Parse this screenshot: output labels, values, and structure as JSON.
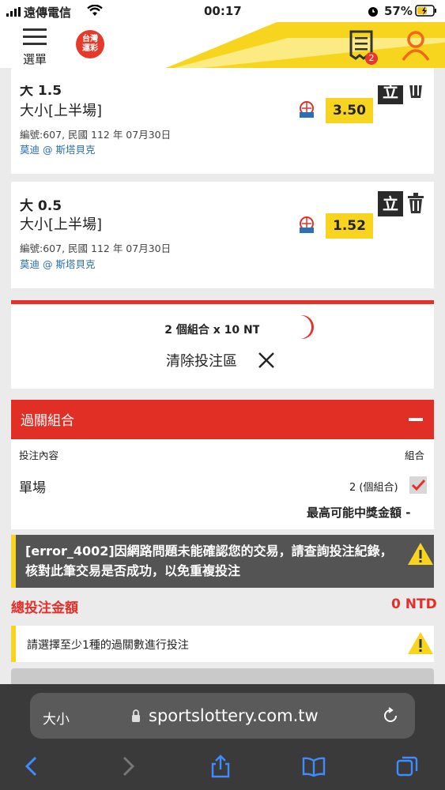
{
  "status_bar": {
    "carrier": "遠傳電信",
    "time": "00:17",
    "battery": "57%"
  },
  "header": {
    "menu_label": "選單",
    "logo_text": "台灣\n運彩",
    "bet_slip_count": "2"
  },
  "bets": [
    {
      "odds_title": "大 1.5",
      "market": "大小[上半場]",
      "meta": "編號:607, 民國 112 年 07月30日",
      "match": "莫迪 @ 斯塔貝克",
      "odds": "3.50",
      "action": "立"
    },
    {
      "odds_title": "大 0.5",
      "market": "大小[上半場]",
      "meta": "編號:607, 民國 112 年 07月30日",
      "match": "莫迪 @ 斯塔貝克",
      "odds": "1.52",
      "action": "立"
    }
  ],
  "stake": {
    "summary": "2 個組合 x 10 NTD x",
    "clear_label": "清除投注區"
  },
  "parlay": {
    "title": "過關組合",
    "header_content": "投注內容",
    "header_combo": "組合",
    "type_label": "單場",
    "combo_count": "2 (個組合)",
    "max_payout_label": "最高可能中獎金額 -"
  },
  "error_message": "[error_4002]因網路問題未能確認您的交易，請查詢投注紀錄，核對此筆交易是否成功，以免重複投注",
  "total": {
    "label": "總投注金額",
    "value": "0 NTD"
  },
  "notice": "請選擇至少1種的過關數進行投注",
  "browser": {
    "text_size_label": "大小",
    "url": "sportslottery.com.tw"
  },
  "colors": {
    "accent_red": "#e22f25",
    "accent_yellow": "#f7d51f"
  }
}
